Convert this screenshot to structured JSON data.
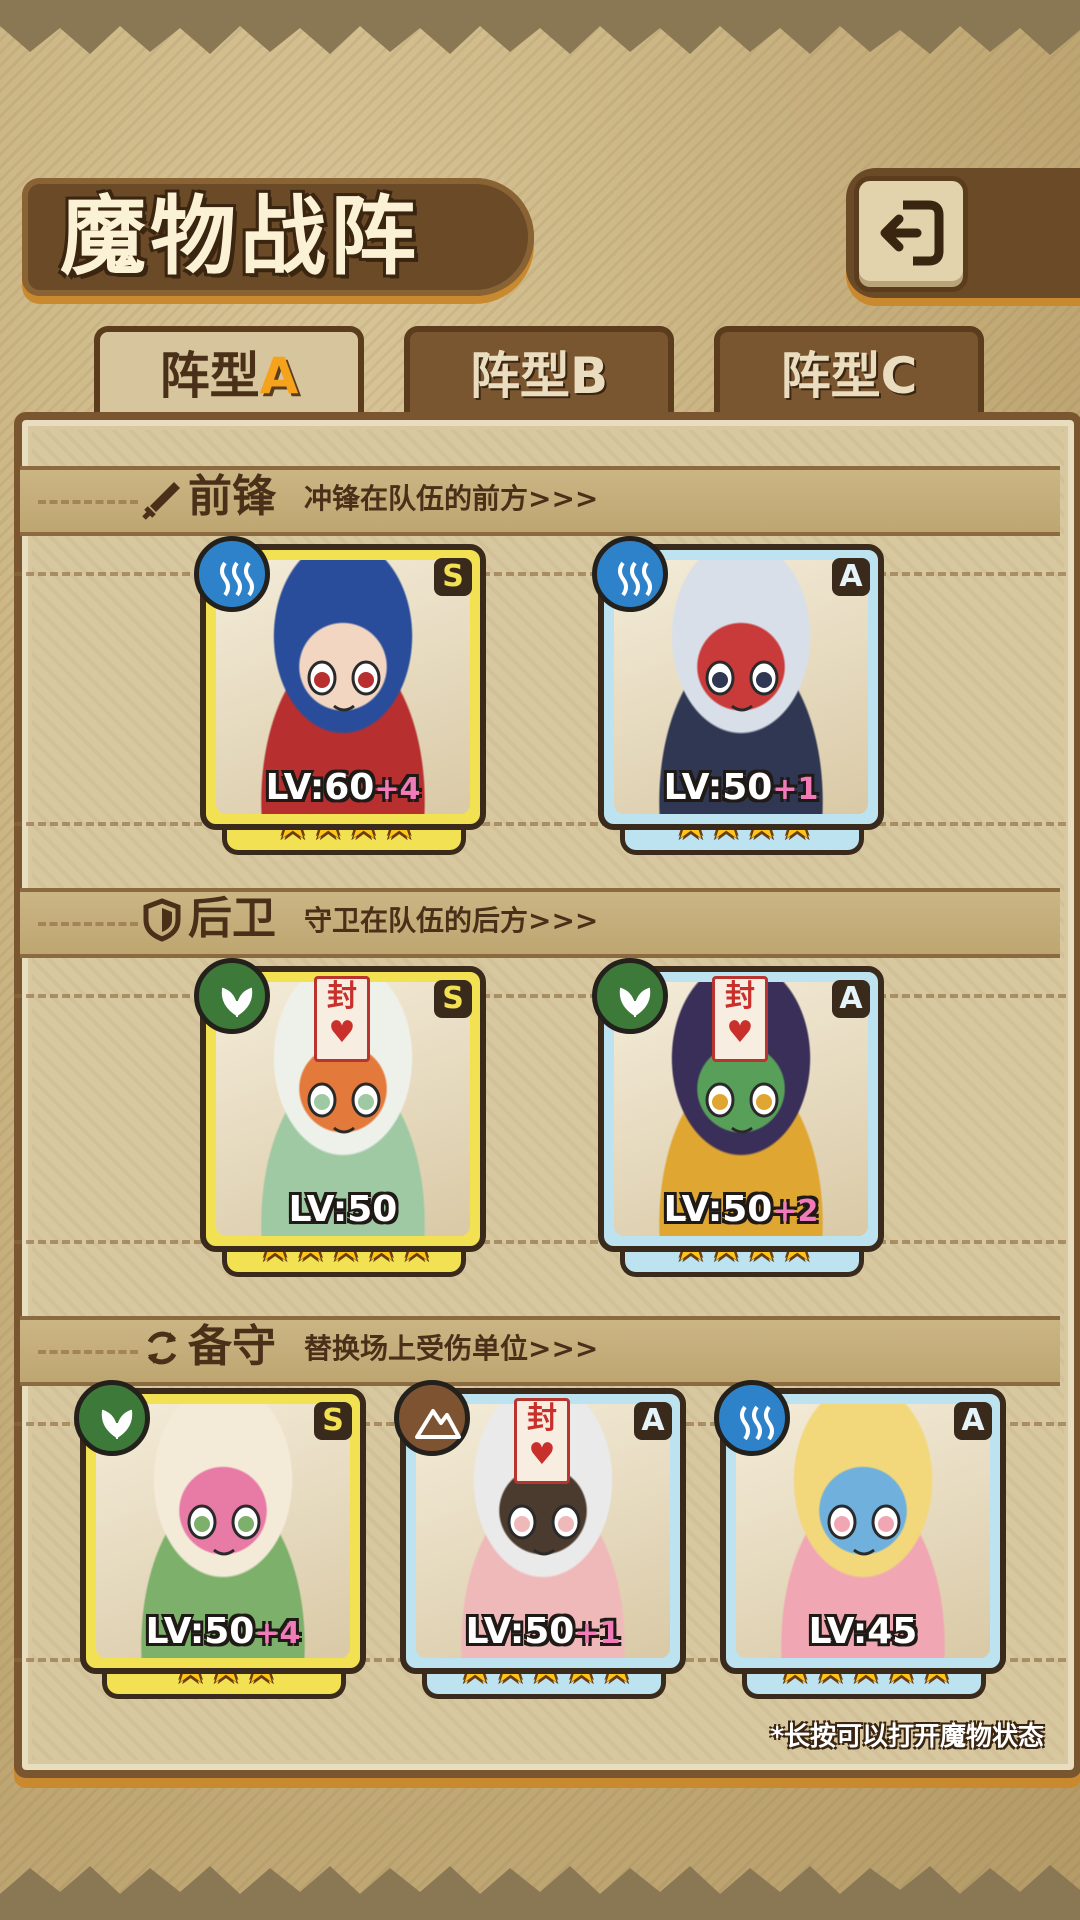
{
  "header": {
    "title": "魔物战阵",
    "back_icon": "back-arrow-icon"
  },
  "tabs": [
    {
      "label": "阵型",
      "letter": "A",
      "active": true
    },
    {
      "label": "阵型",
      "letter": "B",
      "active": false
    },
    {
      "label": "阵型",
      "letter": "C",
      "active": false
    }
  ],
  "sections": {
    "front": {
      "title": "前锋",
      "desc": "冲锋在队伍的前方>>>",
      "icon": "sword-icon"
    },
    "back": {
      "title": "后卫",
      "desc": "守卫在队伍的后方>>>",
      "icon": "shield-icon"
    },
    "reserve": {
      "title": "备守",
      "desc": "替换场上受伤单位>>>",
      "icon": "swap-icon"
    }
  },
  "cards": {
    "front": [
      {
        "rank": "S",
        "element": "water",
        "level": "LV:60",
        "plus": "+4",
        "stars": "★★★★",
        "star_count": 4,
        "colors": [
          "#2a4d9b",
          "#b72f2f",
          "#f2d6c2"
        ]
      },
      {
        "rank": "A",
        "element": "water",
        "level": "LV:50",
        "plus": "+1",
        "stars": "★★★★",
        "star_count": 4,
        "colors": [
          "#d9dfe8",
          "#2f3752",
          "#c93a3a"
        ]
      }
    ],
    "back": [
      {
        "rank": "S",
        "element": "leaf",
        "level": "LV:50",
        "plus": "",
        "stars": "★★★★★",
        "star_count": 5,
        "colors": [
          "#eef0ea",
          "#9fc9a3",
          "#e37a3c"
        ]
      },
      {
        "rank": "A",
        "element": "leaf",
        "level": "LV:50",
        "plus": "+2",
        "stars": "★★★★",
        "star_count": 4,
        "colors": [
          "#3a2f58",
          "#e0a632",
          "#58a05a"
        ]
      }
    ],
    "reserve": [
      {
        "rank": "S",
        "element": "leaf",
        "level": "LV:50",
        "plus": "+4",
        "stars": "★★★",
        "star_count": 3,
        "colors": [
          "#f4ead8",
          "#7db06a",
          "#e87aa6"
        ]
      },
      {
        "rank": "A",
        "element": "earth",
        "level": "LV:50",
        "plus": "+1",
        "stars": "★★★★★",
        "star_count": 5,
        "colors": [
          "#eaeaea",
          "#f0b9b9",
          "#4b3b2f"
        ]
      },
      {
        "rank": "A",
        "element": "water",
        "level": "LV:45",
        "plus": "",
        "stars": "★★★★★",
        "star_count": 5,
        "colors": [
          "#f3d77b",
          "#f1a7b3",
          "#6fb0dd"
        ]
      }
    ]
  },
  "talisman_text": "封",
  "hint": "*长按可以打开魔物状态"
}
